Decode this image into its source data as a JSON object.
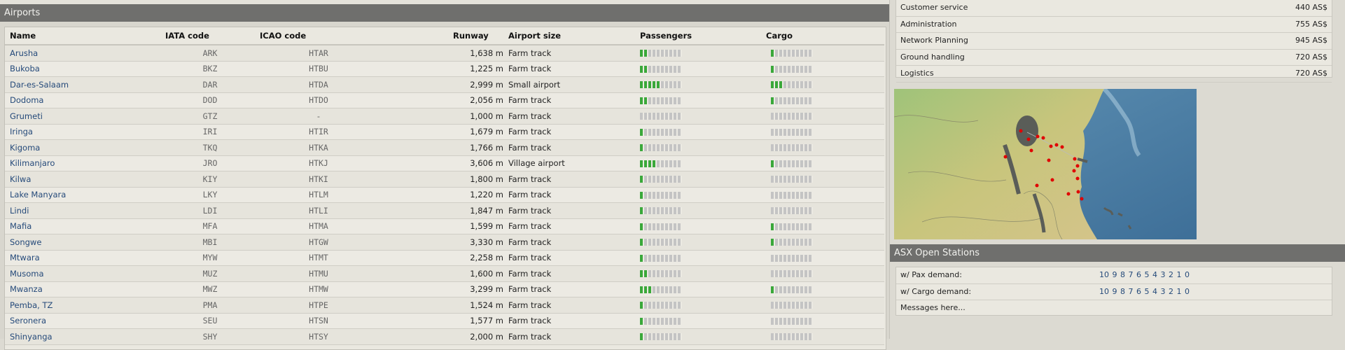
{
  "airports_panel": {
    "title": "Airports",
    "columns": [
      "Name",
      "IATA code",
      "ICAO code",
      "Runway",
      "Airport size",
      "Passengers",
      "Cargo"
    ],
    "rows": [
      {
        "name": "Arusha",
        "iata": "ARK",
        "icao": "HTAR",
        "runway": "1,638 m",
        "size": "Farm track",
        "pax_level": 0.2,
        "cargo_level": 0.1
      },
      {
        "name": "Bukoba",
        "iata": "BKZ",
        "icao": "HTBU",
        "runway": "1,225 m",
        "size": "Farm track",
        "pax_level": 0.2,
        "cargo_level": 0.1
      },
      {
        "name": "Dar-es-Salaam",
        "iata": "DAR",
        "icao": "HTDA",
        "runway": "2,999 m",
        "size": "Small airport",
        "pax_level": 0.5,
        "cargo_level": 0.3
      },
      {
        "name": "Dodoma",
        "iata": "DOD",
        "icao": "HTDO",
        "runway": "2,056 m",
        "size": "Farm track",
        "pax_level": 0.2,
        "cargo_level": 0.1
      },
      {
        "name": "Grumeti",
        "iata": "GTZ",
        "icao": "-",
        "runway": "1,000 m",
        "size": "Farm track",
        "pax_level": 0,
        "cargo_level": 0
      },
      {
        "name": "Iringa",
        "iata": "IRI",
        "icao": "HTIR",
        "runway": "1,679 m",
        "size": "Farm track",
        "pax_level": 0.1,
        "cargo_level": 0
      },
      {
        "name": "Kigoma",
        "iata": "TKQ",
        "icao": "HTKA",
        "runway": "1,766 m",
        "size": "Farm track",
        "pax_level": 0.1,
        "cargo_level": 0
      },
      {
        "name": "Kilimanjaro",
        "iata": "JRO",
        "icao": "HTKJ",
        "runway": "3,606 m",
        "size": "Village airport",
        "pax_level": 0.4,
        "cargo_level": 0.1
      },
      {
        "name": "Kilwa",
        "iata": "KIY",
        "icao": "HTKI",
        "runway": "1,800 m",
        "size": "Farm track",
        "pax_level": 0.1,
        "cargo_level": 0
      },
      {
        "name": "Lake Manyara",
        "iata": "LKY",
        "icao": "HTLM",
        "runway": "1,220 m",
        "size": "Farm track",
        "pax_level": 0.1,
        "cargo_level": 0
      },
      {
        "name": "Lindi",
        "iata": "LDI",
        "icao": "HTLI",
        "runway": "1,847 m",
        "size": "Farm track",
        "pax_level": 0.1,
        "cargo_level": 0
      },
      {
        "name": "Mafia",
        "iata": "MFA",
        "icao": "HTMA",
        "runway": "1,599 m",
        "size": "Farm track",
        "pax_level": 0.1,
        "cargo_level": 0.1
      },
      {
        "name": "Songwe",
        "iata": "MBI",
        "icao": "HTGW",
        "runway": "3,330 m",
        "size": "Farm track",
        "pax_level": 0.1,
        "cargo_level": 0.1
      },
      {
        "name": "Mtwara",
        "iata": "MYW",
        "icao": "HTMT",
        "runway": "2,258 m",
        "size": "Farm track",
        "pax_level": 0.1,
        "cargo_level": 0
      },
      {
        "name": "Musoma",
        "iata": "MUZ",
        "icao": "HTMU",
        "runway": "1,600 m",
        "size": "Farm track",
        "pax_level": 0.2,
        "cargo_level": 0
      },
      {
        "name": "Mwanza",
        "iata": "MWZ",
        "icao": "HTMW",
        "runway": "3,299 m",
        "size": "Farm track",
        "pax_level": 0.3,
        "cargo_level": 0.1
      },
      {
        "name": "Pemba, TZ",
        "iata": "PMA",
        "icao": "HTPE",
        "runway": "1,524 m",
        "size": "Farm track",
        "pax_level": 0.1,
        "cargo_level": 0
      },
      {
        "name": "Seronera",
        "iata": "SEU",
        "icao": "HTSN",
        "runway": "1,577 m",
        "size": "Farm track",
        "pax_level": 0.1,
        "cargo_level": 0
      },
      {
        "name": "Shinyanga",
        "iata": "SHY",
        "icao": "HTSY",
        "runway": "2,000 m",
        "size": "Farm track",
        "pax_level": 0.1,
        "cargo_level": 0
      }
    ]
  },
  "fees": [
    {
      "label": "Customer service",
      "value": "440 AS$"
    },
    {
      "label": "Administration",
      "value": "755 AS$"
    },
    {
      "label": "Network Planning",
      "value": "945 AS$"
    },
    {
      "label": "Ground handling",
      "value": "720 AS$"
    },
    {
      "label": "Logistics",
      "value": "720 AS$"
    }
  ],
  "map": {
    "icon": "tanzania-map"
  },
  "asx": {
    "title": "ASX Open Stations",
    "pax_label": "w/ Pax demand:",
    "pax_numbers": [
      "10",
      "9",
      "8",
      "7",
      "6",
      "5",
      "4",
      "3",
      "2",
      "1",
      "0"
    ],
    "cargo_label": "w/ Cargo demand:",
    "cargo_numbers": [
      "10",
      "9",
      "8",
      "7",
      "6",
      "5",
      "4",
      "3",
      "2",
      "1",
      "0"
    ],
    "messages": "Messages here..."
  },
  "colors": {
    "header_bg": "#6f6f6d",
    "link": "#254a7a",
    "meter_fill": "#3aa83a",
    "meter_empty": "#c4c4c4",
    "airport_dot": "#e00000"
  }
}
